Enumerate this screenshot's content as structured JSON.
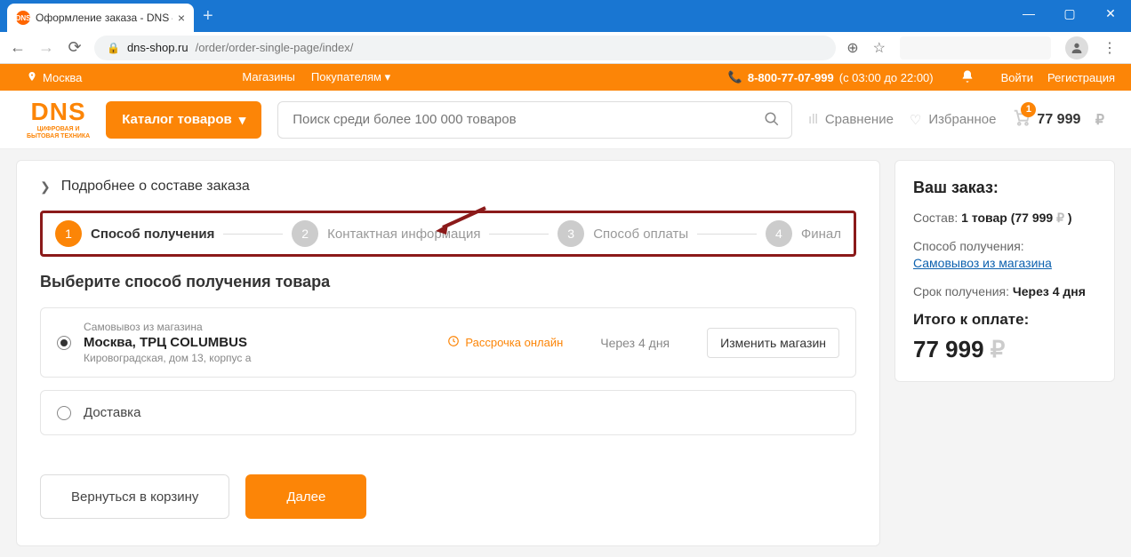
{
  "browser": {
    "tab_title": "Оформление заказа - DNS – ин",
    "url_host": "dns-shop.ru",
    "url_path": "/order/order-single-page/index/"
  },
  "topbar": {
    "city": "Москва",
    "stores": "Магазины",
    "buyers": "Покупателям",
    "phone": "8-800-77-07-999",
    "hours": "(с 03:00 до 22:00)",
    "login": "Войти",
    "register": "Регистрация"
  },
  "header": {
    "logo": "DNS",
    "logo_sub": "ЦИФРОВАЯ И\nБЫТОВАЯ ТЕХНИКА",
    "catalog": "Каталог товаров",
    "search_placeholder": "Поиск среди более 100 000 товаров",
    "compare": "Сравнение",
    "favorites": "Избранное",
    "cart_badge": "1",
    "cart_total": "77 999"
  },
  "accordion": "Подробнее о составе заказа",
  "steps": [
    {
      "num": "1",
      "label": "Способ получения",
      "active": true
    },
    {
      "num": "2",
      "label": "Контактная информация",
      "active": false
    },
    {
      "num": "3",
      "label": "Способ оплаты",
      "active": false
    },
    {
      "num": "4",
      "label": "Финал",
      "active": false
    }
  ],
  "hint": "Выберите способ получения товара",
  "pickup": {
    "subtitle": "Самовывоз из магазина",
    "title": "Москва, ТРЦ COLUMBUS",
    "address": "Кировоградская, дом 13, корпус а",
    "installment": "Рассрочка онлайн",
    "eta": "Через 4 дня",
    "change": "Изменить магазин"
  },
  "delivery_label": "Доставка",
  "actions": {
    "back": "Вернуться в корзину",
    "next": "Далее"
  },
  "side": {
    "title": "Ваш заказ:",
    "composition_label": "Состав:",
    "composition_value": "1 товар (77 999",
    "method_label": "Способ получения:",
    "method_link": "Самовывоз из магазина",
    "eta_label": "Срок получения:",
    "eta_value": "Через 4 дня",
    "total_label": "Итого к оплате:",
    "total_value": "77 999"
  }
}
